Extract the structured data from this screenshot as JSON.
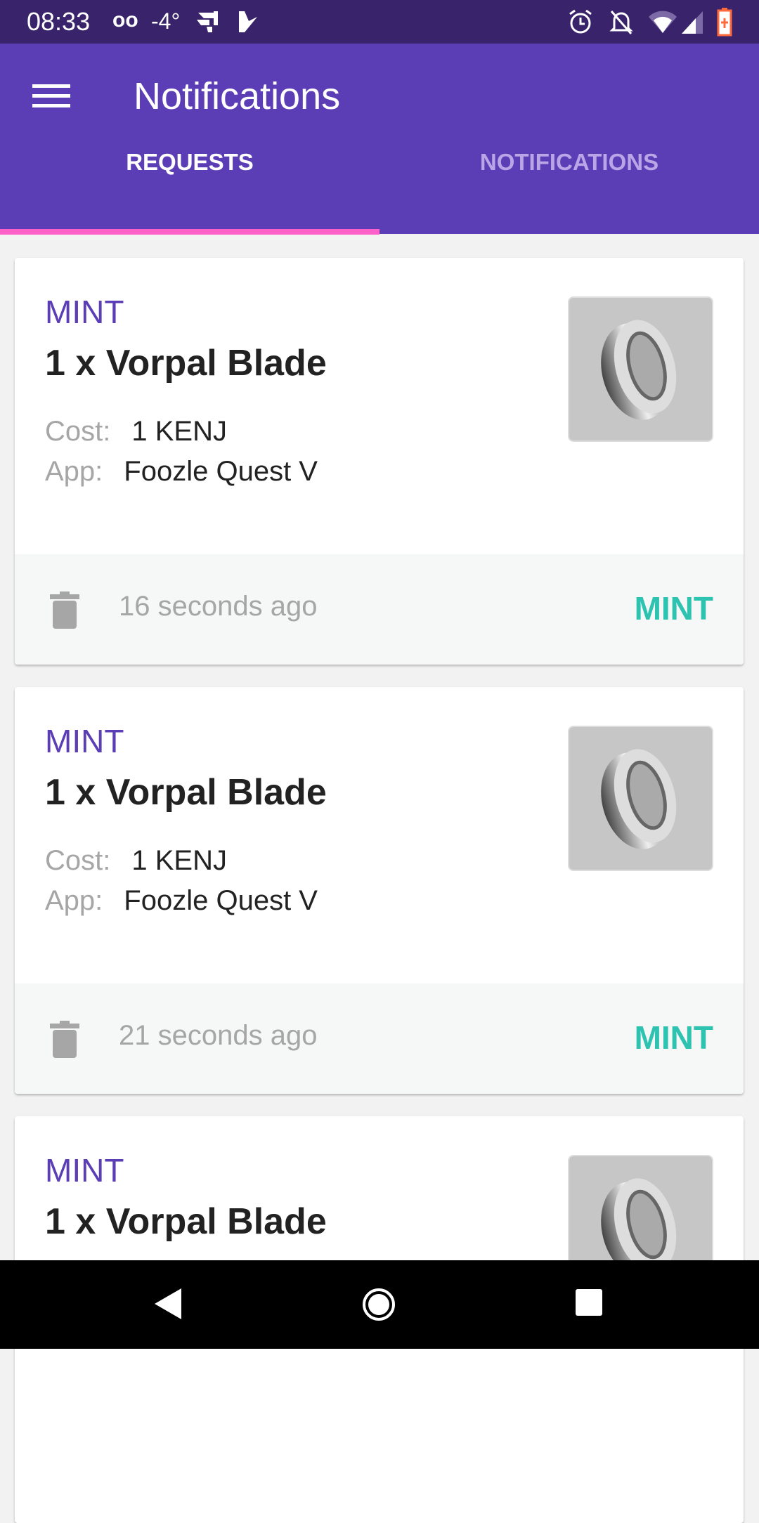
{
  "status_bar": {
    "time": "08:33",
    "voicemail": "oo",
    "temperature": "-4°"
  },
  "app_bar": {
    "title": "Notifications"
  },
  "tabs": [
    {
      "label": "REQUESTS",
      "active": true
    },
    {
      "label": "NOTIFICATIONS",
      "active": false
    }
  ],
  "colors": {
    "primary": "#5b3db5",
    "status": "#39236b",
    "accent": "#ff5fc8",
    "mint": "#2ec2b0"
  },
  "cards": [
    {
      "kind": "MINT",
      "title": "1 x Vorpal Blade",
      "cost_label": "Cost:",
      "cost": "1 KENJ",
      "app_label": "App:",
      "app": "Foozle Quest V",
      "time": "16 seconds ago",
      "action": "MINT"
    },
    {
      "kind": "MINT",
      "title": "1 x Vorpal Blade",
      "cost_label": "Cost:",
      "cost": "1 KENJ",
      "app_label": "App:",
      "app": "Foozle Quest V",
      "time": "21 seconds ago",
      "action": "MINT"
    },
    {
      "kind": "MINT",
      "title": "1 x Vorpal Blade"
    }
  ]
}
